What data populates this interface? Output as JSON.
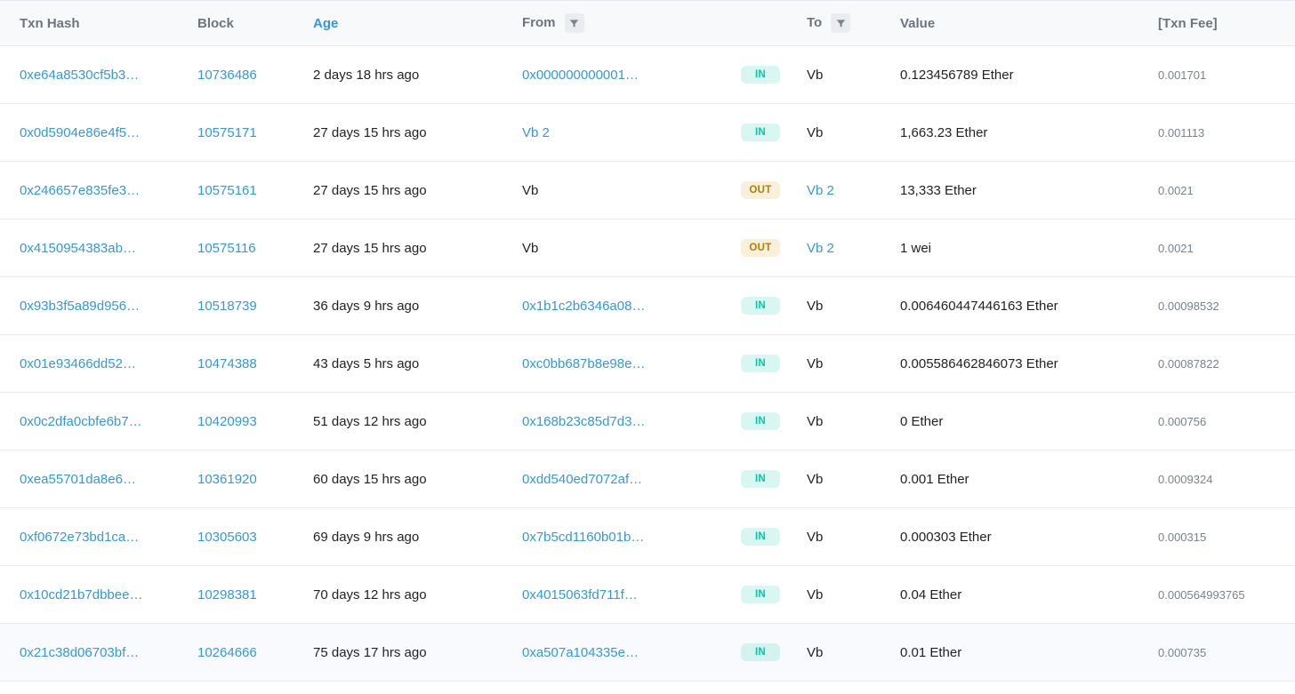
{
  "columns": {
    "hash": "Txn Hash",
    "block": "Block",
    "age": "Age",
    "from": "From",
    "to": "To",
    "value": "Value",
    "fee": "[Txn Fee]"
  },
  "direction": {
    "IN": "IN",
    "OUT": "OUT"
  },
  "rows": [
    {
      "hash": "0xe64a8530cf5b3…",
      "block": "10736486",
      "age": "2 days 18 hrs ago",
      "from": "0x000000000001…",
      "fromLink": true,
      "dir": "IN",
      "to": "Vb",
      "toLink": false,
      "value": "0.123456789 Ether",
      "fee": "0.001701"
    },
    {
      "hash": "0x0d5904e86e4f5…",
      "block": "10575171",
      "age": "27 days 15 hrs ago",
      "from": "Vb 2",
      "fromLink": true,
      "dir": "IN",
      "to": "Vb",
      "toLink": false,
      "value": "1,663.23 Ether",
      "fee": "0.001113"
    },
    {
      "hash": "0x246657e835fe3…",
      "block": "10575161",
      "age": "27 days 15 hrs ago",
      "from": "Vb",
      "fromLink": false,
      "dir": "OUT",
      "to": "Vb 2",
      "toLink": true,
      "value": "13,333 Ether",
      "fee": "0.0021"
    },
    {
      "hash": "0x4150954383ab…",
      "block": "10575116",
      "age": "27 days 15 hrs ago",
      "from": "Vb",
      "fromLink": false,
      "dir": "OUT",
      "to": "Vb 2",
      "toLink": true,
      "value": "1 wei",
      "fee": "0.0021"
    },
    {
      "hash": "0x93b3f5a89d956…",
      "block": "10518739",
      "age": "36 days 9 hrs ago",
      "from": "0x1b1c2b6346a08…",
      "fromLink": true,
      "dir": "IN",
      "to": "Vb",
      "toLink": false,
      "value": "0.006460447446163 Ether",
      "fee": "0.00098532"
    },
    {
      "hash": "0x01e93466dd52…",
      "block": "10474388",
      "age": "43 days 5 hrs ago",
      "from": "0xc0bb687b8e98e…",
      "fromLink": true,
      "dir": "IN",
      "to": "Vb",
      "toLink": false,
      "value": "0.005586462846073 Ether",
      "fee": "0.00087822"
    },
    {
      "hash": "0x0c2dfa0cbfe6b7…",
      "block": "10420993",
      "age": "51 days 12 hrs ago",
      "from": "0x168b23c85d7d3…",
      "fromLink": true,
      "dir": "IN",
      "to": "Vb",
      "toLink": false,
      "value": "0 Ether",
      "fee": "0.000756"
    },
    {
      "hash": "0xea55701da8e6…",
      "block": "10361920",
      "age": "60 days 15 hrs ago",
      "from": "0xdd540ed7072af…",
      "fromLink": true,
      "dir": "IN",
      "to": "Vb",
      "toLink": false,
      "value": "0.001 Ether",
      "fee": "0.0009324"
    },
    {
      "hash": "0xf0672e73bd1ca…",
      "block": "10305603",
      "age": "69 days 9 hrs ago",
      "from": "0x7b5cd1160b01b…",
      "fromLink": true,
      "dir": "IN",
      "to": "Vb",
      "toLink": false,
      "value": "0.000303 Ether",
      "fee": "0.000315"
    },
    {
      "hash": "0x10cd21b7dbbee…",
      "block": "10298381",
      "age": "70 days 12 hrs ago",
      "from": "0x4015063fd711f…",
      "fromLink": true,
      "dir": "IN",
      "to": "Vb",
      "toLink": false,
      "value": "0.04 Ether",
      "fee": "0.000564993765"
    },
    {
      "hash": "0x21c38d06703bf…",
      "block": "10264666",
      "age": "75 days 17 hrs ago",
      "from": "0xa507a104335e…",
      "fromLink": true,
      "dir": "IN",
      "to": "Vb",
      "toLink": false,
      "value": "0.01 Ether",
      "fee": "0.000735"
    }
  ],
  "hoveredRowIndex": 10
}
